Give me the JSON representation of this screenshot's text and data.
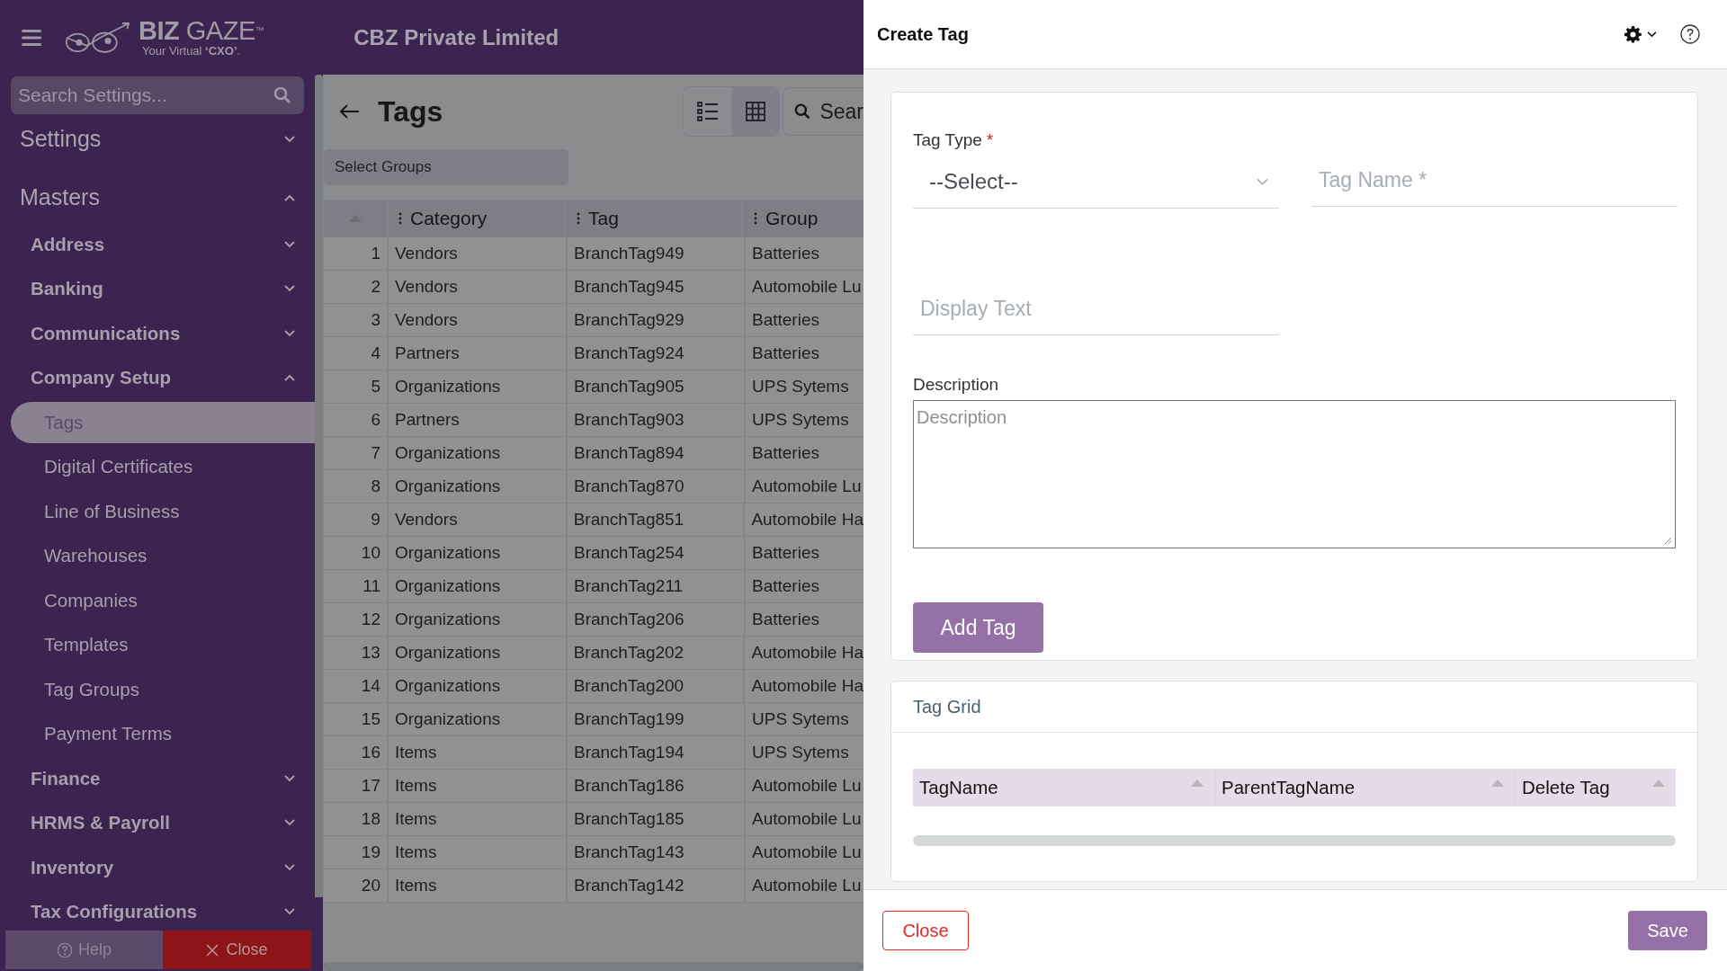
{
  "header": {
    "logo": {
      "name_bold": "BIZ",
      "name_light": "GAZE",
      "mark": "™",
      "tagline": "Your Virtual **‘CXO’**."
    },
    "company": "CBZ Private Limited"
  },
  "sidebar": {
    "search": {
      "placeholder": "Search Settings..."
    },
    "items": [
      {
        "label": "Settings",
        "kind": "section",
        "expanded": false
      },
      {
        "label": "Masters",
        "kind": "section",
        "expanded": true,
        "children": [
          {
            "label": "Address",
            "kind": "group",
            "expanded": false
          },
          {
            "label": "Banking",
            "kind": "group",
            "expanded": false
          },
          {
            "label": "Communications",
            "kind": "group",
            "expanded": false
          },
          {
            "label": "Company Setup",
            "kind": "group",
            "expanded": true,
            "children": [
              {
                "label": "Tags",
                "kind": "item",
                "selected": true
              },
              {
                "label": "Digital Certificates",
                "kind": "item",
                "selected": false
              },
              {
                "label": "Line of Business",
                "kind": "item",
                "selected": false
              },
              {
                "label": "Warehouses",
                "kind": "item",
                "selected": false
              },
              {
                "label": "Companies",
                "kind": "item",
                "selected": false
              },
              {
                "label": "Templates",
                "kind": "item",
                "selected": false
              },
              {
                "label": "Tag Groups",
                "kind": "item",
                "selected": false
              },
              {
                "label": "Payment Terms",
                "kind": "item",
                "selected": false
              }
            ]
          },
          {
            "label": "Finance",
            "kind": "group",
            "expanded": false
          },
          {
            "label": "HRMS & Payroll",
            "kind": "group",
            "expanded": false
          },
          {
            "label": "Inventory",
            "kind": "group",
            "expanded": false
          },
          {
            "label": "Tax Configurations",
            "kind": "group",
            "expanded": false
          }
        ]
      }
    ],
    "footer": [
      {
        "label": "Help",
        "kind": "help"
      },
      {
        "label": "Close",
        "kind": "close"
      }
    ]
  },
  "page": {
    "title": "Tags",
    "views": [
      {
        "kind": "list",
        "selected": false
      },
      {
        "kind": "grid",
        "selected": true
      }
    ],
    "search": {
      "placeholder": "Sear"
    },
    "group_filter": {
      "placeholder": "Select Groups"
    },
    "table": {
      "columns": [
        "",
        "Category",
        "Tag",
        "Group"
      ],
      "rows": [
        [
          "1",
          "Vendors",
          "BranchTag949",
          "Batteries"
        ],
        [
          "2",
          "Vendors",
          "BranchTag945",
          "Automobile Lu"
        ],
        [
          "3",
          "Vendors",
          "BranchTag929",
          "Batteries"
        ],
        [
          "4",
          "Partners",
          "BranchTag924",
          "Batteries"
        ],
        [
          "5",
          "Organizations",
          "BranchTag905",
          "UPS Sytems"
        ],
        [
          "6",
          "Partners",
          "BranchTag903",
          "UPS Sytems"
        ],
        [
          "7",
          "Organizations",
          "BranchTag894",
          "Batteries"
        ],
        [
          "8",
          "Organizations",
          "BranchTag870",
          "Automobile Lu"
        ],
        [
          "9",
          "Vendors",
          "BranchTag851",
          "Automobile Ha"
        ],
        [
          "10",
          "Organizations",
          "BranchTag254",
          "Batteries"
        ],
        [
          "11",
          "Organizations",
          "BranchTag211",
          "Batteries"
        ],
        [
          "12",
          "Organizations",
          "BranchTag206",
          "Batteries"
        ],
        [
          "13",
          "Organizations",
          "BranchTag202",
          "Automobile Ha"
        ],
        [
          "14",
          "Organizations",
          "BranchTag200",
          "Automobile Ha"
        ],
        [
          "15",
          "Organizations",
          "BranchTag199",
          "UPS Sytems"
        ],
        [
          "16",
          "Items",
          "BranchTag194",
          "UPS Sytems"
        ],
        [
          "17",
          "Items",
          "BranchTag186",
          "Automobile Lu"
        ],
        [
          "18",
          "Items",
          "BranchTag185",
          "Automobile Lu"
        ],
        [
          "19",
          "Items",
          "BranchTag143",
          "Automobile Lu"
        ],
        [
          "20",
          "Items",
          "BranchTag142",
          "Automobile Lu"
        ]
      ]
    }
  },
  "dialog": {
    "title": "Create Tag",
    "form": {
      "tag_type": {
        "label": "Tag Type",
        "required_mark": "*",
        "value": "--Select--"
      },
      "tag_name": {
        "placeholder": "Tag Name *"
      },
      "display_text": {
        "placeholder": "Display Text"
      },
      "description": {
        "label": "Description",
        "placeholder": "Description"
      },
      "add_button": "Add Tag"
    },
    "tag_grid": {
      "title": "Tag Grid",
      "columns": [
        "TagName",
        "ParentTagName",
        "Delete Tag"
      ]
    },
    "buttons": [
      {
        "label": "Close",
        "kind": "secondary"
      },
      {
        "label": "Save",
        "kind": "primary"
      }
    ]
  }
}
